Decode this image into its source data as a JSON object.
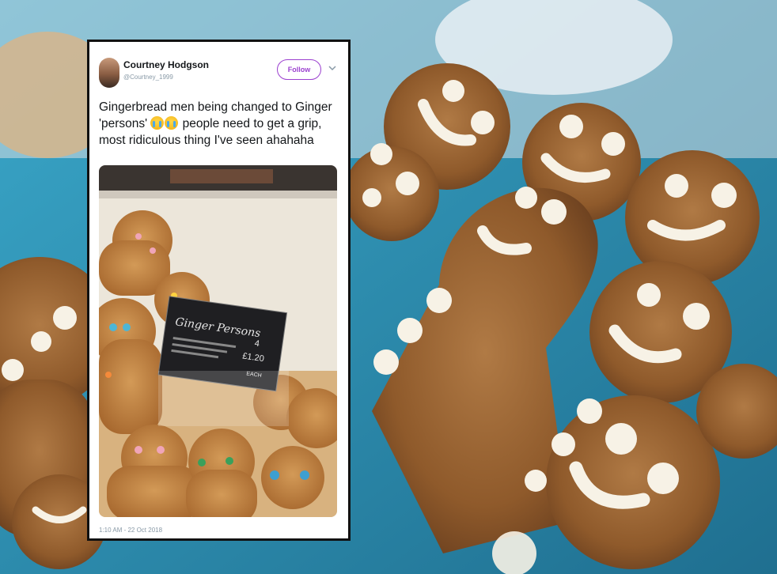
{
  "tweet": {
    "display_name": "Courtney Hodgson",
    "handle": "@Courtney_1999",
    "follow_label": "Follow",
    "text_part1": "Gingerbread men being changed to Ginger 'persons' ",
    "text_part2": " people need to get a grip, most ridiculous thing I've seen ahahaha",
    "emojis": [
      "crying-laughing-emoji",
      "crying-laughing-emoji"
    ],
    "timestamp": "1:10 AM - 22 Oct 2018"
  },
  "photo_sign": {
    "title": "Ginger Persons",
    "price_top": "4",
    "price_main": "£1.20",
    "price_bottom": "EACH"
  },
  "colors": {
    "follow_accent": "#9b3fcf",
    "tweet_text": "#14171a",
    "meta_text": "#8899a6",
    "card_border": "#111111"
  }
}
